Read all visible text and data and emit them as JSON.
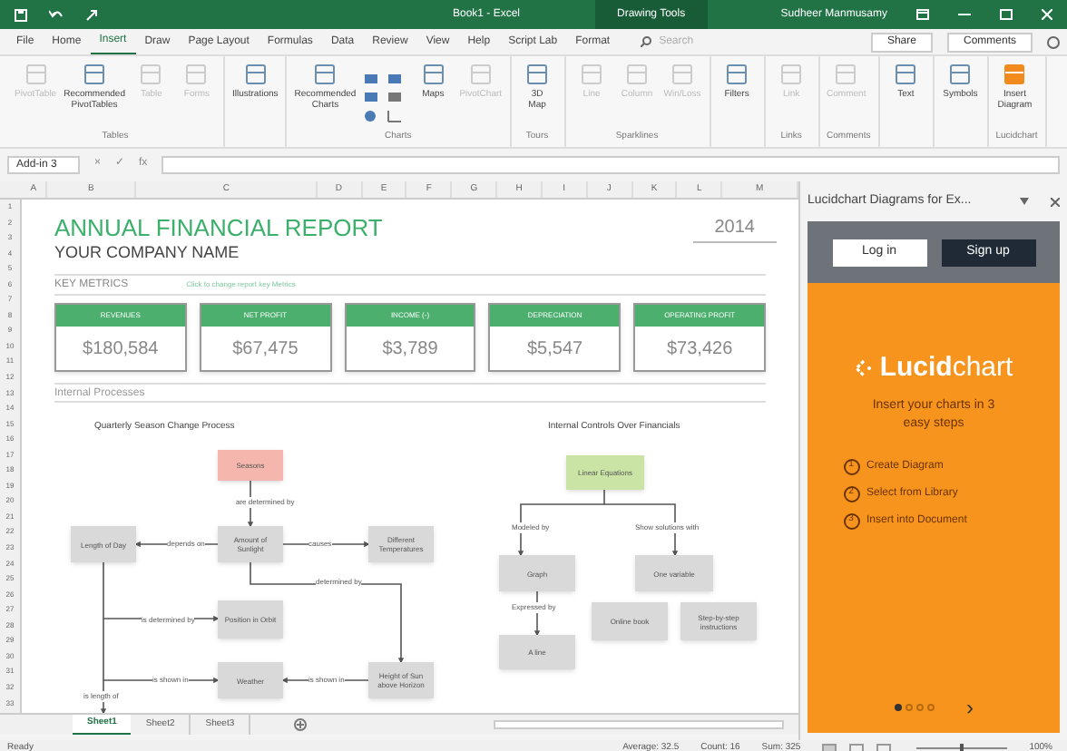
{
  "title_bar": {
    "title": "Book1 - Excel",
    "context_tab": "Drawing Tools",
    "user": "Sudheer Manmusamy"
  },
  "menu_tabs": [
    {
      "label": "File",
      "selected": false
    },
    {
      "label": "Home",
      "selected": false
    },
    {
      "label": "Insert",
      "selected": true
    },
    {
      "label": "Draw",
      "selected": false
    },
    {
      "label": "Page Layout",
      "selected": false
    },
    {
      "label": "Formulas",
      "selected": false
    },
    {
      "label": "Data",
      "selected": false
    },
    {
      "label": "Review",
      "selected": false
    },
    {
      "label": "View",
      "selected": false
    },
    {
      "label": "Help",
      "selected": false
    },
    {
      "label": "Script Lab",
      "selected": false
    },
    {
      "label": "Format",
      "selected": false
    }
  ],
  "search": {
    "placeholder": "Search"
  },
  "share": "Share",
  "comments": "Comments",
  "ribbon_groups": [
    {
      "label": "Tables",
      "items": [
        {
          "label": "PivotTable",
          "disabled": true
        },
        {
          "label": "Recommended PivotTables",
          "disabled": false
        },
        {
          "label": "Table",
          "disabled": true
        },
        {
          "label": "Forms",
          "disabled": true
        }
      ]
    },
    {
      "items": [
        {
          "label": "Illustrations",
          "disabled": false
        }
      ]
    },
    {
      "label": "Charts",
      "items": [
        {
          "label": "Recommended Charts",
          "disabled": false
        },
        {
          "label": "Maps",
          "disabled": false
        },
        {
          "label": "PivotChart",
          "disabled": true
        }
      ]
    },
    {
      "label": "Tours",
      "items": [
        {
          "label": "3D Map",
          "disabled": false
        }
      ]
    },
    {
      "label": "Sparklines",
      "items": [
        {
          "label": "Line",
          "disabled": true
        },
        {
          "label": "Column",
          "disabled": true
        },
        {
          "label": "Win/Loss",
          "disabled": true
        }
      ]
    },
    {
      "items": [
        {
          "label": "Filters",
          "disabled": false
        }
      ]
    },
    {
      "label": "Links",
      "items": [
        {
          "label": "Link",
          "disabled": true
        }
      ]
    },
    {
      "label": "Comments",
      "items": [
        {
          "label": "Comment",
          "disabled": true
        }
      ]
    },
    {
      "items": [
        {
          "label": "Text",
          "disabled": false
        }
      ]
    },
    {
      "items": [
        {
          "label": "Symbols",
          "disabled": false
        }
      ]
    },
    {
      "label": "Lucidchart",
      "items": [
        {
          "label": "Insert Diagram",
          "disabled": false
        }
      ]
    }
  ],
  "name_box": "Add-in 3",
  "formula_buttons": [
    "×",
    "✓",
    "fx"
  ],
  "column_headers": [
    "A",
    "B",
    "C",
    "D",
    "E",
    "F",
    "G",
    "H",
    "I",
    "J",
    "K",
    "L",
    "M"
  ],
  "row_numbers": [
    "1",
    "2",
    "3",
    "4",
    "5",
    "6",
    "7",
    "8",
    "9",
    "10",
    "11",
    "12",
    "13",
    "14",
    "15",
    "16",
    "17",
    "18",
    "19",
    "20",
    "21",
    "22",
    "23",
    "24",
    "25",
    "26",
    "27",
    "28",
    "29",
    "30",
    "31",
    "32",
    "33"
  ],
  "report": {
    "title": "ANNUAL FINANCIAL REPORT",
    "company": "YOUR COMPANY NAME",
    "year": "2014",
    "key_metrics": "KEY METRICS",
    "hint": "Click to change report key Metrics",
    "processes": "Internal Processes"
  },
  "metrics": [
    {
      "label": "REVENUES",
      "value": "$180,584"
    },
    {
      "label": "NET PROFIT",
      "value": "$67,475"
    },
    {
      "label": "INCOME (-)",
      "value": "$3,789"
    },
    {
      "label": "DEPRECIATION",
      "value": "$5,547"
    },
    {
      "label": "OPERATING PROFIT",
      "value": "$73,426"
    }
  ],
  "diagrams": [
    {
      "title": "Quarterly Season Change Process",
      "nodes": [
        {
          "label": "Seasons",
          "color": "#f4b6ad"
        },
        {
          "label": "Length of Day",
          "color": "#d9d9d9"
        },
        {
          "label": "Amount of Sunlight",
          "color": "#d9d9d9"
        },
        {
          "label": "Different Temperatures",
          "color": "#d9d9d9"
        },
        {
          "label": "Position in Orbit",
          "color": "#d9d9d9"
        },
        {
          "label": "Weather",
          "color": "#d9d9d9"
        },
        {
          "label": "Height of Sun above Horizon",
          "color": "#d9d9d9"
        }
      ],
      "edge_labels": [
        "are determined by",
        "depends on",
        "causes",
        "determined by",
        "is determined by",
        "is shown in",
        "is shown in",
        "is length of"
      ]
    },
    {
      "title": "Internal Controls Over Financials",
      "nodes": [
        {
          "label": "Linear Equations",
          "color": "#c9e4a4"
        },
        {
          "label": "Graph",
          "color": "#d9d9d9"
        },
        {
          "label": "One variable",
          "color": "#d9d9d9"
        },
        {
          "label": "Online book",
          "color": "#d9d9d9"
        },
        {
          "label": "Step-by-step instructions",
          "color": "#d9d9d9"
        },
        {
          "label": "A line",
          "color": "#d9d9d9"
        }
      ],
      "edge_labels": [
        "Modeled by",
        "Show solutions with",
        "Expressed by"
      ]
    }
  ],
  "sheet_tabs": [
    {
      "label": "Sheet1",
      "selected": true
    },
    {
      "label": "Sheet2",
      "selected": false
    },
    {
      "label": "Sheet3",
      "selected": false
    }
  ],
  "status_bar": {
    "mode": "Ready",
    "average": "Average: 32.5",
    "count": "Count: 16",
    "sum": "Sum: 325",
    "zoom": "100%",
    "zoom_slider": {
      "level": 0.5
    }
  },
  "task_pane": {
    "title": "Lucidchart Diagrams for Ex...",
    "login": "Log in",
    "signup": "Sign up",
    "logo": "**Lucid**chart",
    "tagline": "Insert your charts in 3 easy steps",
    "steps": [
      {
        "number": "1",
        "label": "Create Diagram"
      },
      {
        "number": "2",
        "label": "Select from Library"
      },
      {
        "number": "3",
        "label": "Insert into Document"
      }
    ],
    "pager": [
      {
        "selected": true
      },
      {
        "selected": false
      },
      {
        "selected": false
      },
      {
        "selected": false
      }
    ],
    "next": "›"
  }
}
